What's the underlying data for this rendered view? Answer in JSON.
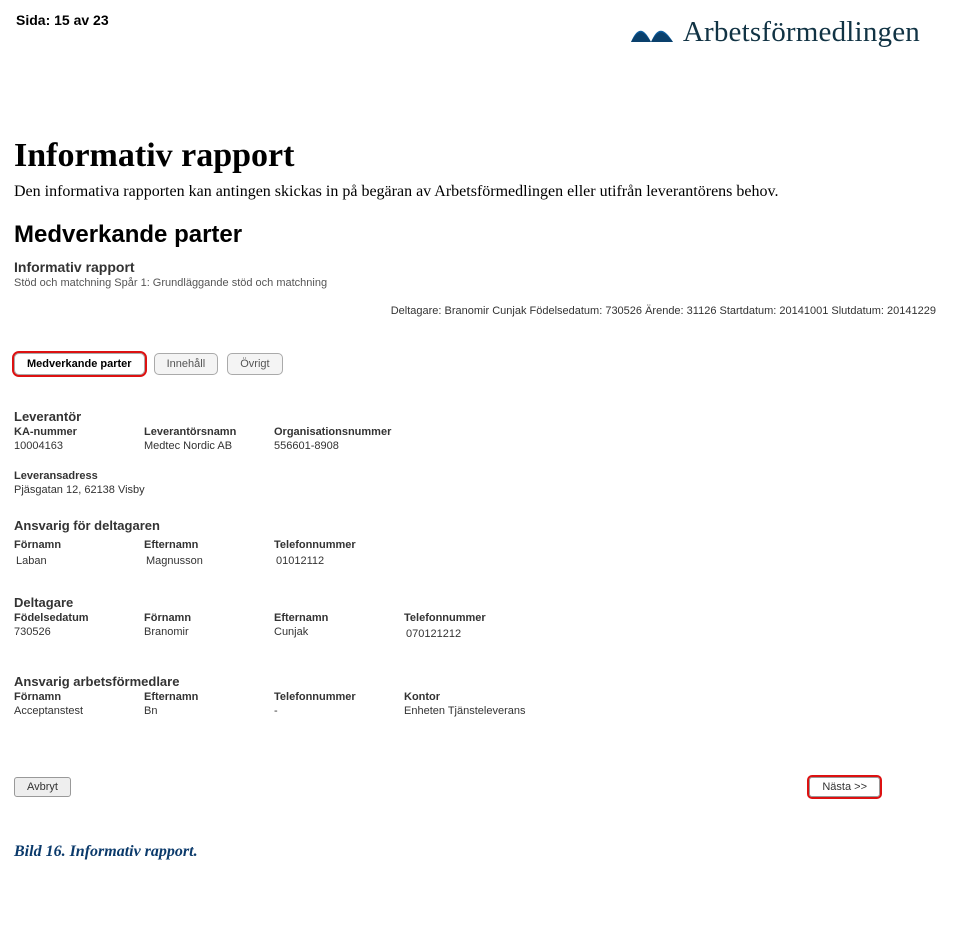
{
  "page_counter": "Sida: 15 av 23",
  "brand": "Arbetsförmedlingen",
  "section": {
    "title": "Informativ rapport",
    "desc": "Den informativa rapporten kan antingen skickas in på begäran av Arbetsförmedlingen eller utifrån leverantörens behov.",
    "subsection": "Medverkande parter"
  },
  "form": {
    "title": "Informativ rapport",
    "subtitle": "Stöd och matchning Spår 1: Grundläggande stöd och matchning",
    "participant_line": "Deltagare: Branomir Cunjak Födelsedatum: 730526 Ärende: 31126 Startdatum: 20141001 Slutdatum: 20141229",
    "tabs": [
      {
        "label": "Medverkande parter",
        "active": true
      },
      {
        "label": "Innehåll",
        "active": false
      },
      {
        "label": "Övrigt",
        "active": false
      }
    ],
    "leverantor": {
      "title": "Leverantör",
      "ka_label": "KA-nummer",
      "ka_value": "10004163",
      "name_label": "Leverantörsnamn",
      "name_value": "Medtec Nordic AB",
      "org_label": "Organisationsnummer",
      "org_value": "556601-8908",
      "addr_label": "Leveransadress",
      "addr_value": "Pjäsgatan 12, 62138 Visby"
    },
    "ansvarig": {
      "title": "Ansvarig för deltagaren",
      "fnamn_label": "Förnamn",
      "fnamn_value": "Laban",
      "enamn_label": "Efternamn",
      "enamn_value": "Magnusson",
      "tel_label": "Telefonnummer",
      "tel_value": "01012112"
    },
    "deltagare": {
      "title": "Deltagare",
      "dob_label": "Födelsedatum",
      "dob_value": "730526",
      "fnamn_label": "Förnamn",
      "fnamn_value": "Branomir",
      "enamn_label": "Efternamn",
      "enamn_value": "Cunjak",
      "tel_label": "Telefonnummer",
      "tel_value": "070121212"
    },
    "formedlare": {
      "title": "Ansvarig arbetsförmedlare",
      "fnamn_label": "Förnamn",
      "fnamn_value": "Acceptanstest",
      "enamn_label": "Efternamn",
      "enamn_value": "Bn",
      "tel_label": "Telefonnummer",
      "tel_value": "-",
      "kontor_label": "Kontor",
      "kontor_value": "Enheten Tjänsteleverans"
    },
    "buttons": {
      "cancel": "Avbryt",
      "next": "Nästa >>"
    }
  },
  "caption": "Bild 16. Informativ rapport."
}
